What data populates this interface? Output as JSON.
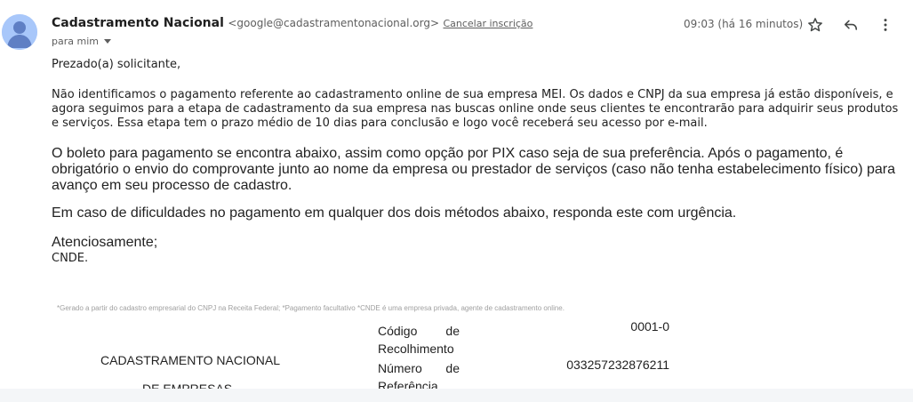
{
  "email": {
    "sender": {
      "name": "Cadastramento Nacional",
      "address": "<google@cadastramentonacional.org>",
      "unsubscribe_label": "Cancelar inscrição"
    },
    "recipient_label": "para mim",
    "time": "09:03 (há 16 minutos)",
    "actions": {
      "star": "star-icon",
      "reply": "reply-icon",
      "more": "more-vert-icon"
    },
    "body": {
      "greeting": "Prezado(a) solicitante,",
      "paragraph_1": "Não identificamos o pagamento referente ao cadastramento online de sua empresa MEI. Os dados e CNPJ da sua empresa já estão disponíveis, e agora seguimos para a etapa de cadastramento da sua empresa nas buscas online onde seus clientes te encontrarão para adquirir seus produtos e serviços. Essa etapa tem o prazo médio de 10 dias para conclusão e logo você receberá seu acesso por e-mail.",
      "paragraph_2": "O boleto para pagamento se encontra abaixo, assim como opção por PIX caso seja de sua preferência. Após o pagamento, é obrigatório o envio do comprovante junto ao nome da empresa ou prestador de serviços (caso não tenha estabelecimento físico) para avanço em seu processo de cadastro.",
      "paragraph_3": "Em caso de dificuldades no pagamento em qualquer dos dois métodos abaixo, responda este com urgência.",
      "closing": "Atenciosamente;",
      "signature": "CNDE."
    },
    "boleto": {
      "footnote": "*Gerado a partir do cadastro empresarial do CNPJ na Receita Federal; *Pagamento facultativo *CNDE é uma empresa privada, agente de cadastramento online.",
      "company_line_1": "CADASTRAMENTO NACIONAL",
      "company_line_2": "DE EMPRESAS",
      "fields": [
        {
          "label_1": "Código de",
          "label_2": "Recolhimento",
          "value": "0001-0"
        },
        {
          "label_1": "Número de",
          "label_2": "Referência",
          "value": "033257232876211"
        }
      ]
    }
  },
  "colors": {
    "avatar_bg": "#a8c7fa",
    "avatar_fg": "#5f7fc4",
    "muted_text": "#5e5e5e",
    "body_text": "#222222"
  }
}
